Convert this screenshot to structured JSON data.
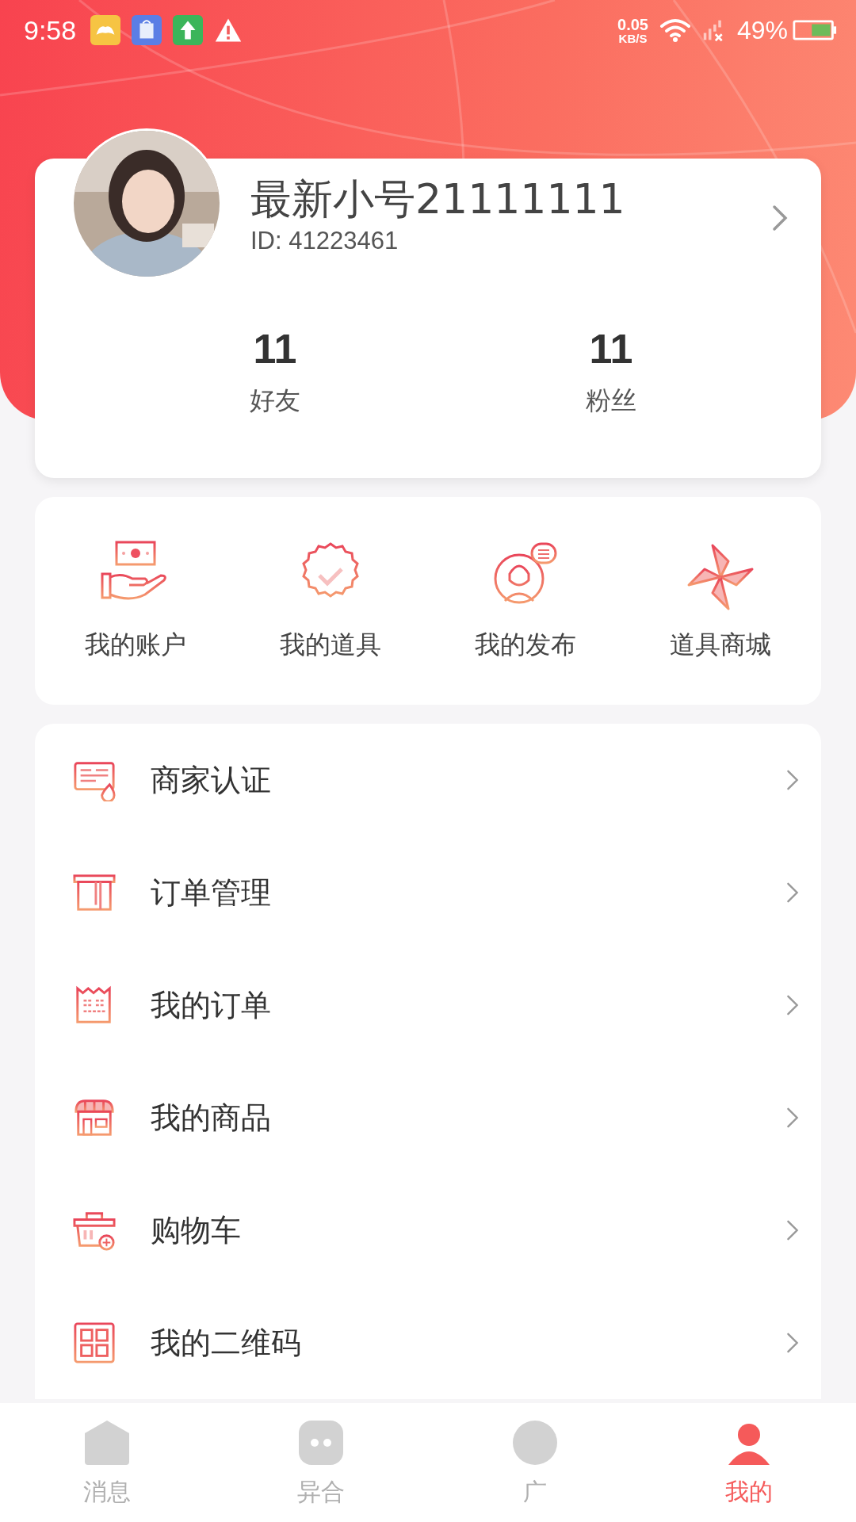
{
  "status_bar": {
    "time": "9:58",
    "network_speed": "0.05",
    "speed_unit": "KB/S",
    "battery": "49%"
  },
  "profile": {
    "name": "最新小号21111111",
    "id": "ID: 41223461",
    "stats": [
      {
        "value": "11",
        "label": "好友"
      },
      {
        "value": "11",
        "label": "粉丝"
      }
    ]
  },
  "shortcuts": [
    {
      "label": "我的账户"
    },
    {
      "label": "我的道具"
    },
    {
      "label": "我的发布"
    },
    {
      "label": "道具商城"
    }
  ],
  "menu": [
    {
      "label": "商家认证"
    },
    {
      "label": "订单管理"
    },
    {
      "label": "我的订单"
    },
    {
      "label": "我的商品"
    },
    {
      "label": "购物车"
    },
    {
      "label": "我的二维码"
    }
  ],
  "tabs": [
    {
      "label": "消息",
      "selected": false
    },
    {
      "label": "异合",
      "selected": false
    },
    {
      "label": "广",
      "selected": false
    },
    {
      "label": "我的",
      "selected": true
    }
  ]
}
